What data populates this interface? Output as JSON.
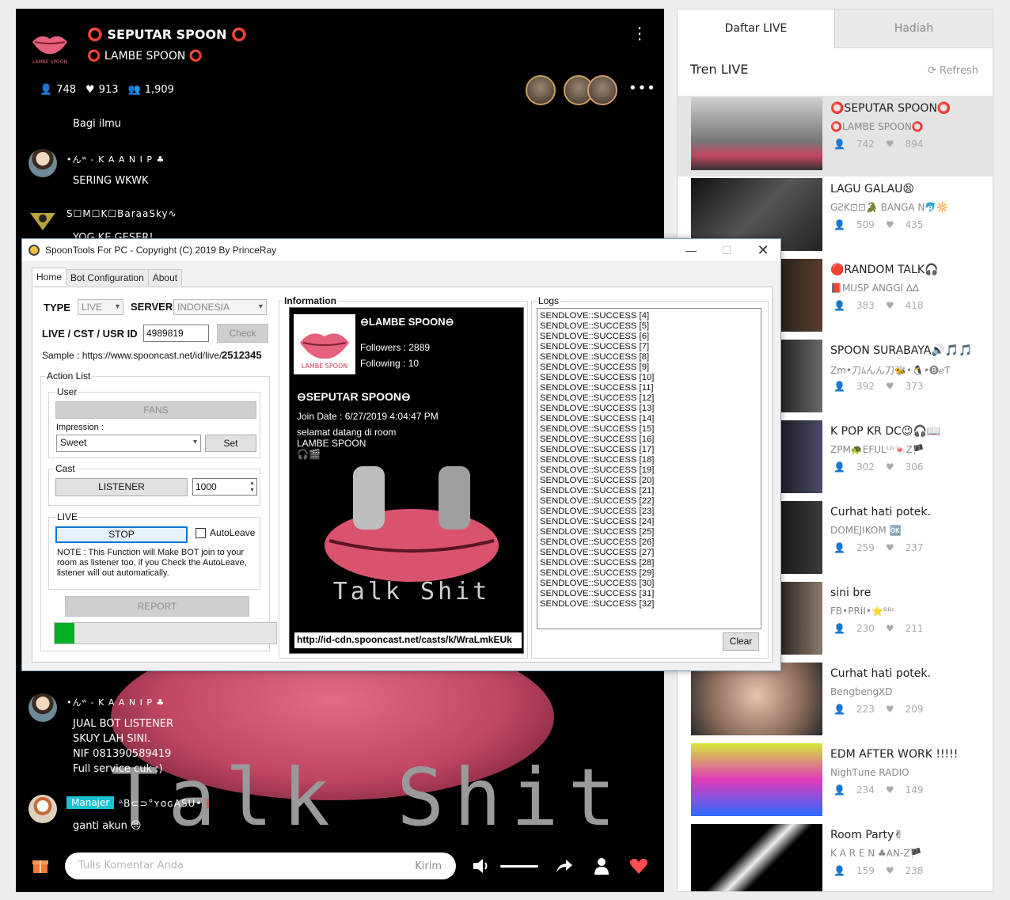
{
  "room": {
    "title": "⭕ SEPUTAR SPOON ⭕",
    "host": "⭕ LAMBE SPOON ⭕",
    "logo_text": "LAMBE SPOON",
    "listeners": "748",
    "likes": "913",
    "total": "1,909",
    "bg_text": "Talk Shit",
    "messages": [
      {
        "name": "",
        "text": "Bagi ilmu"
      },
      {
        "name": "•んʷ - K A A N I P ♣",
        "text": "SERING WKWK"
      },
      {
        "name": "S☐M☐K☐BaraaSky∿",
        "text": "YOG KE GESER!"
      },
      {
        "name": "•んʷ - K A A N I P ♣",
        "lines": [
          "JUAL BOT LISTENER",
          "SKUY LAH SINI.",
          "NIF 081390589419",
          "Full service cuk :)"
        ]
      },
      {
        "name": "ᴬB⊂⊃°ʏᴏɢASU•❗",
        "badge": "Manajer",
        "text": "ganti akun 😣"
      }
    ],
    "comment_placeholder": "Tulis Komentar Anda",
    "send_label": "Kirim"
  },
  "panel": {
    "tab_live": "Daftar LIVE",
    "tab_gift": "Hadiah",
    "heading": "Tren LIVE",
    "refresh": "Refresh",
    "items": [
      {
        "title": "⭕SEPUTAR SPOON⭕",
        "host": "⭕LAMBE SPOON⭕",
        "listeners": "742",
        "likes": "894"
      },
      {
        "title": "LAGU GALAU😫",
        "host": "GƧK⊡⊡🐊 BANGA N🐬🔆",
        "listeners": "509",
        "likes": "435"
      },
      {
        "title": "🔴RANDOM TALK🎧",
        "host": "📕MUSP ANGGI ∆∆",
        "listeners": "383",
        "likes": "418"
      },
      {
        "title": "SPOON SURABAYA🔊🎵🎵",
        "host": "Zm•刀ﾑんん刀🐝•🐧•🅑ℯƬ",
        "listeners": "392",
        "likes": "373"
      },
      {
        "title": "K POP KR DC😉🎧📖",
        "host": "ZPM🐢EFULᴸᴳ🍬Z🏴",
        "listeners": "302",
        "likes": "306"
      },
      {
        "title": "Curhat hati potek.",
        "host": "DOMEJIKOM 🆗",
        "listeners": "259",
        "likes": "237"
      },
      {
        "title": "sini bre",
        "host": "FB•PRII•⭐ᴮᴮᶜ",
        "listeners": "230",
        "likes": "211"
      },
      {
        "title": "Curhat hati potek.",
        "host": "BengbengXD",
        "listeners": "223",
        "likes": "209"
      },
      {
        "title": "EDM AFTER WORK !!!!!",
        "host": "NighƬune RADIO",
        "listeners": "234",
        "likes": "149"
      },
      {
        "title": "Room Party✌",
        "host": "K A R E N ♣AN-Z🏴",
        "listeners": "159",
        "likes": "238"
      }
    ]
  },
  "tool": {
    "title": "SpoonTools For PC - Copyright (C) 2019 By PrinceRay",
    "tabs": [
      "Home",
      "Bot Configuration",
      "About"
    ],
    "type_label": "TYPE",
    "type_value": "LIVE",
    "server_label": "SERVER",
    "server_value": "INDONESIA",
    "id_label": "LIVE / CST / USR ID",
    "id_value": "4989819",
    "check": "Check",
    "sample": "Sample : https://www.spooncast.net/id/live/",
    "sample_id": "2512345",
    "action_list": "Action List",
    "user_group": "User",
    "fans": "FANS",
    "impression_label": "Impression :",
    "impression_value": "Sweet",
    "set": "Set",
    "cast_group": "Cast",
    "listener": "LISTENER",
    "count": "1000",
    "live_group": "LIVE",
    "stop": "STOP",
    "autoleave": "AutoLeave",
    "note": "NOTE : This Function will Make BOT join to your room as listener too, if you Check the AutoLeave, listener will out automatically.",
    "report": "REPORT",
    "progress": 0.09,
    "info_label": "Information",
    "info": {
      "name": "⊖LAMBE SPOON⊖",
      "followers": "Followers : 2889",
      "following": "Following : 10",
      "room": "⊖SEPUTAR SPOON⊖",
      "join": "Join Date : 6/27/2019 4:04:47 PM",
      "desc1": "selamat datang di room",
      "desc2": "LAMBE SPOON",
      "desc3": "🎧🎬",
      "art_text": "Talk Shit",
      "url": "http://id-cdn.spooncast.net/casts/k/WraLmkEUk"
    },
    "logs_label": "Logs",
    "logs": [
      "SENDLOVE::SUCCESS [4]",
      "SENDLOVE::SUCCESS [5]",
      "SENDLOVE::SUCCESS [6]",
      "SENDLOVE::SUCCESS [7]",
      "SENDLOVE::SUCCESS [8]",
      "SENDLOVE::SUCCESS [9]",
      "SENDLOVE::SUCCESS [10]",
      "SENDLOVE::SUCCESS [11]",
      "SENDLOVE::SUCCESS [12]",
      "SENDLOVE::SUCCESS [13]",
      "SENDLOVE::SUCCESS [14]",
      "SENDLOVE::SUCCESS [15]",
      "SENDLOVE::SUCCESS [16]",
      "SENDLOVE::SUCCESS [17]",
      "SENDLOVE::SUCCESS [18]",
      "SENDLOVE::SUCCESS [19]",
      "SENDLOVE::SUCCESS [20]",
      "SENDLOVE::SUCCESS [21]",
      "SENDLOVE::SUCCESS [22]",
      "SENDLOVE::SUCCESS [23]",
      "SENDLOVE::SUCCESS [24]",
      "SENDLOVE::SUCCESS [25]",
      "SENDLOVE::SUCCESS [26]",
      "SENDLOVE::SUCCESS [27]",
      "SENDLOVE::SUCCESS [28]",
      "SENDLOVE::SUCCESS [29]",
      "SENDLOVE::SUCCESS [30]",
      "SENDLOVE::SUCCESS [31]",
      "SENDLOVE::SUCCESS [32]"
    ],
    "clear": "Clear"
  },
  "colors": {
    "accent_heart": "#ff4d4d",
    "progress": "#06b025",
    "badge": "#1ac2d6",
    "lips": "#d9536f"
  },
  "icons": [
    "lips-logo",
    "kebab-icon",
    "user-icon",
    "heart-icon",
    "users-icon",
    "gift-icon",
    "volume-icon",
    "share-icon",
    "profile-icon",
    "refresh-icon"
  ]
}
